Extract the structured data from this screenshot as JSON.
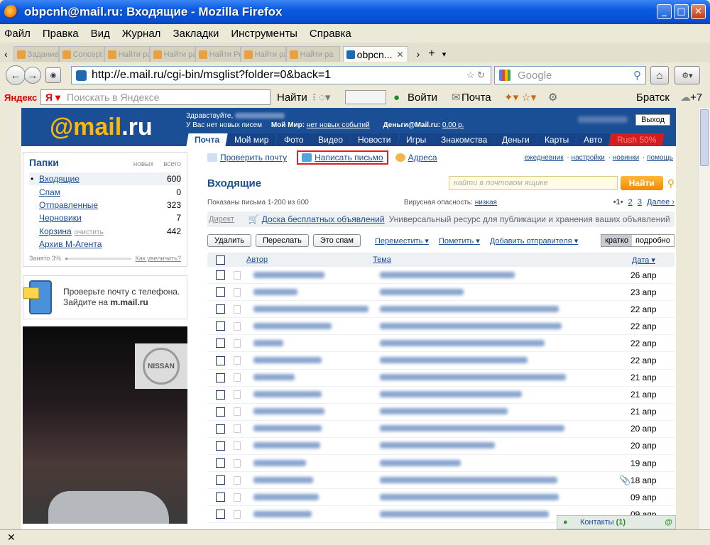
{
  "window": {
    "title": "obpcnh@mail.ru: Входящие - Mozilla Firefox"
  },
  "menu": [
    "Файл",
    "Правка",
    "Вид",
    "Журнал",
    "Закладки",
    "Инструменты",
    "Справка"
  ],
  "tabs": {
    "active": "obpcn...",
    "others": [
      "Задание",
      "Concept",
      "Найти ра",
      "Найти ра",
      "Найти Ре",
      "Найти ра",
      "Найти ра"
    ]
  },
  "nav": {
    "url": "http://e.mail.ru/cgi-bin/msglist?folder=0&back=1",
    "search_placeholder": "Google"
  },
  "yandex": {
    "logo": "Яндекс",
    "search_placeholder": "Поискать в Яндексе",
    "find": "Найти",
    "login": "Войти",
    "mail": "Почта",
    "city": "Братск",
    "temp": "+7"
  },
  "mail": {
    "logo_at": "@mail",
    "logo_ru": ".ru",
    "greeting": "Здравствуйте,",
    "no_new": "У Вас нет новых писем",
    "my_world": "Мой Мир:",
    "no_events": "нет новых событий",
    "money": "Деньги@Mail.ru:",
    "money_val": "0,00 р.",
    "exit": "Выход",
    "tabs": [
      "Почта",
      "Мой мир",
      "Фото",
      "Видео",
      "Новости",
      "Игры",
      "Знакомства",
      "Деньги",
      "Карты",
      "Авто"
    ],
    "tab_red": "Rush 50%"
  },
  "sidebar": {
    "folders_title": "Папки",
    "col_new": "новых",
    "col_total": "всего",
    "folders": [
      {
        "name": "Входящие",
        "count": "600"
      },
      {
        "name": "Спам",
        "count": "0"
      },
      {
        "name": "Отправленные",
        "count": "323"
      },
      {
        "name": "Черновики",
        "count": "7"
      },
      {
        "name": "Корзина",
        "count": "442",
        "extra": "очистить"
      },
      {
        "name": "Архив М-Агента",
        "count": ""
      }
    ],
    "usage_label": "Занято 3%",
    "usage_pct": 0.03,
    "usage_link": "Как увеличить?",
    "mobile_text1": "Проверьте почту с телефона.",
    "mobile_text2": "Зайдите на",
    "mobile_link": "m.mail.ru",
    "ad_brand": "NISSAN"
  },
  "main": {
    "check_mail": "Проверить почту",
    "compose": "Написать письмо",
    "addresses": "Адреса",
    "right_links": [
      "ежедневник",
      "настройки",
      "новинки",
      "помощь"
    ],
    "title": "Входящие",
    "search_placeholder": "найти в почтовом ящике",
    "find_btn": "Найти",
    "shown": "Показаны письма 1-200 из 600",
    "virus_label": "Вирусная опасность:",
    "virus_value": "низкая",
    "pages": {
      "current": "•1•",
      "p2": "2",
      "p3": "3",
      "next": "Далее ›"
    },
    "direct": "Директ",
    "direct_ad": "Доска бесплатных объявлений",
    "direct_text": "Универсальный ресурс для публикации и хранения ваших объявлений",
    "buttons": [
      "Удалить",
      "Переслать",
      "Это спам"
    ],
    "dropdowns": [
      "Переместить",
      "Пометить",
      "Добавить отправителя"
    ],
    "view_short": "кратко",
    "view_full": "подробно",
    "col_author": "Автор",
    "col_subject": "Тема",
    "col_date": "Дата",
    "rows": [
      {
        "date": "26 апр",
        "sw": 100,
        "tw": 190
      },
      {
        "date": "23 апр",
        "sw": 62,
        "tw": 118
      },
      {
        "date": "22 апр",
        "sw": 162,
        "tw": 252
      },
      {
        "date": "22 апр",
        "sw": 110,
        "tw": 256
      },
      {
        "date": "22 апр",
        "sw": 42,
        "tw": 232
      },
      {
        "date": "22 апр",
        "sw": 96,
        "tw": 208
      },
      {
        "date": "21 апр",
        "sw": 58,
        "tw": 262
      },
      {
        "date": "21 апр",
        "sw": 96,
        "tw": 200
      },
      {
        "date": "21 апр",
        "sw": 100,
        "tw": 180
      },
      {
        "date": "20 апр",
        "sw": 96,
        "tw": 260
      },
      {
        "date": "20 апр",
        "sw": 94,
        "tw": 162
      },
      {
        "date": "19 апр",
        "sw": 74,
        "tw": 114
      },
      {
        "date": "18 апр",
        "sw": 84,
        "tw": 250,
        "attach": true
      },
      {
        "date": "09 апр",
        "sw": 92,
        "tw": 252
      },
      {
        "date": "09 апр",
        "sw": 82,
        "tw": 238
      }
    ],
    "contacts": "Контакты",
    "contacts_count": "(1)"
  }
}
